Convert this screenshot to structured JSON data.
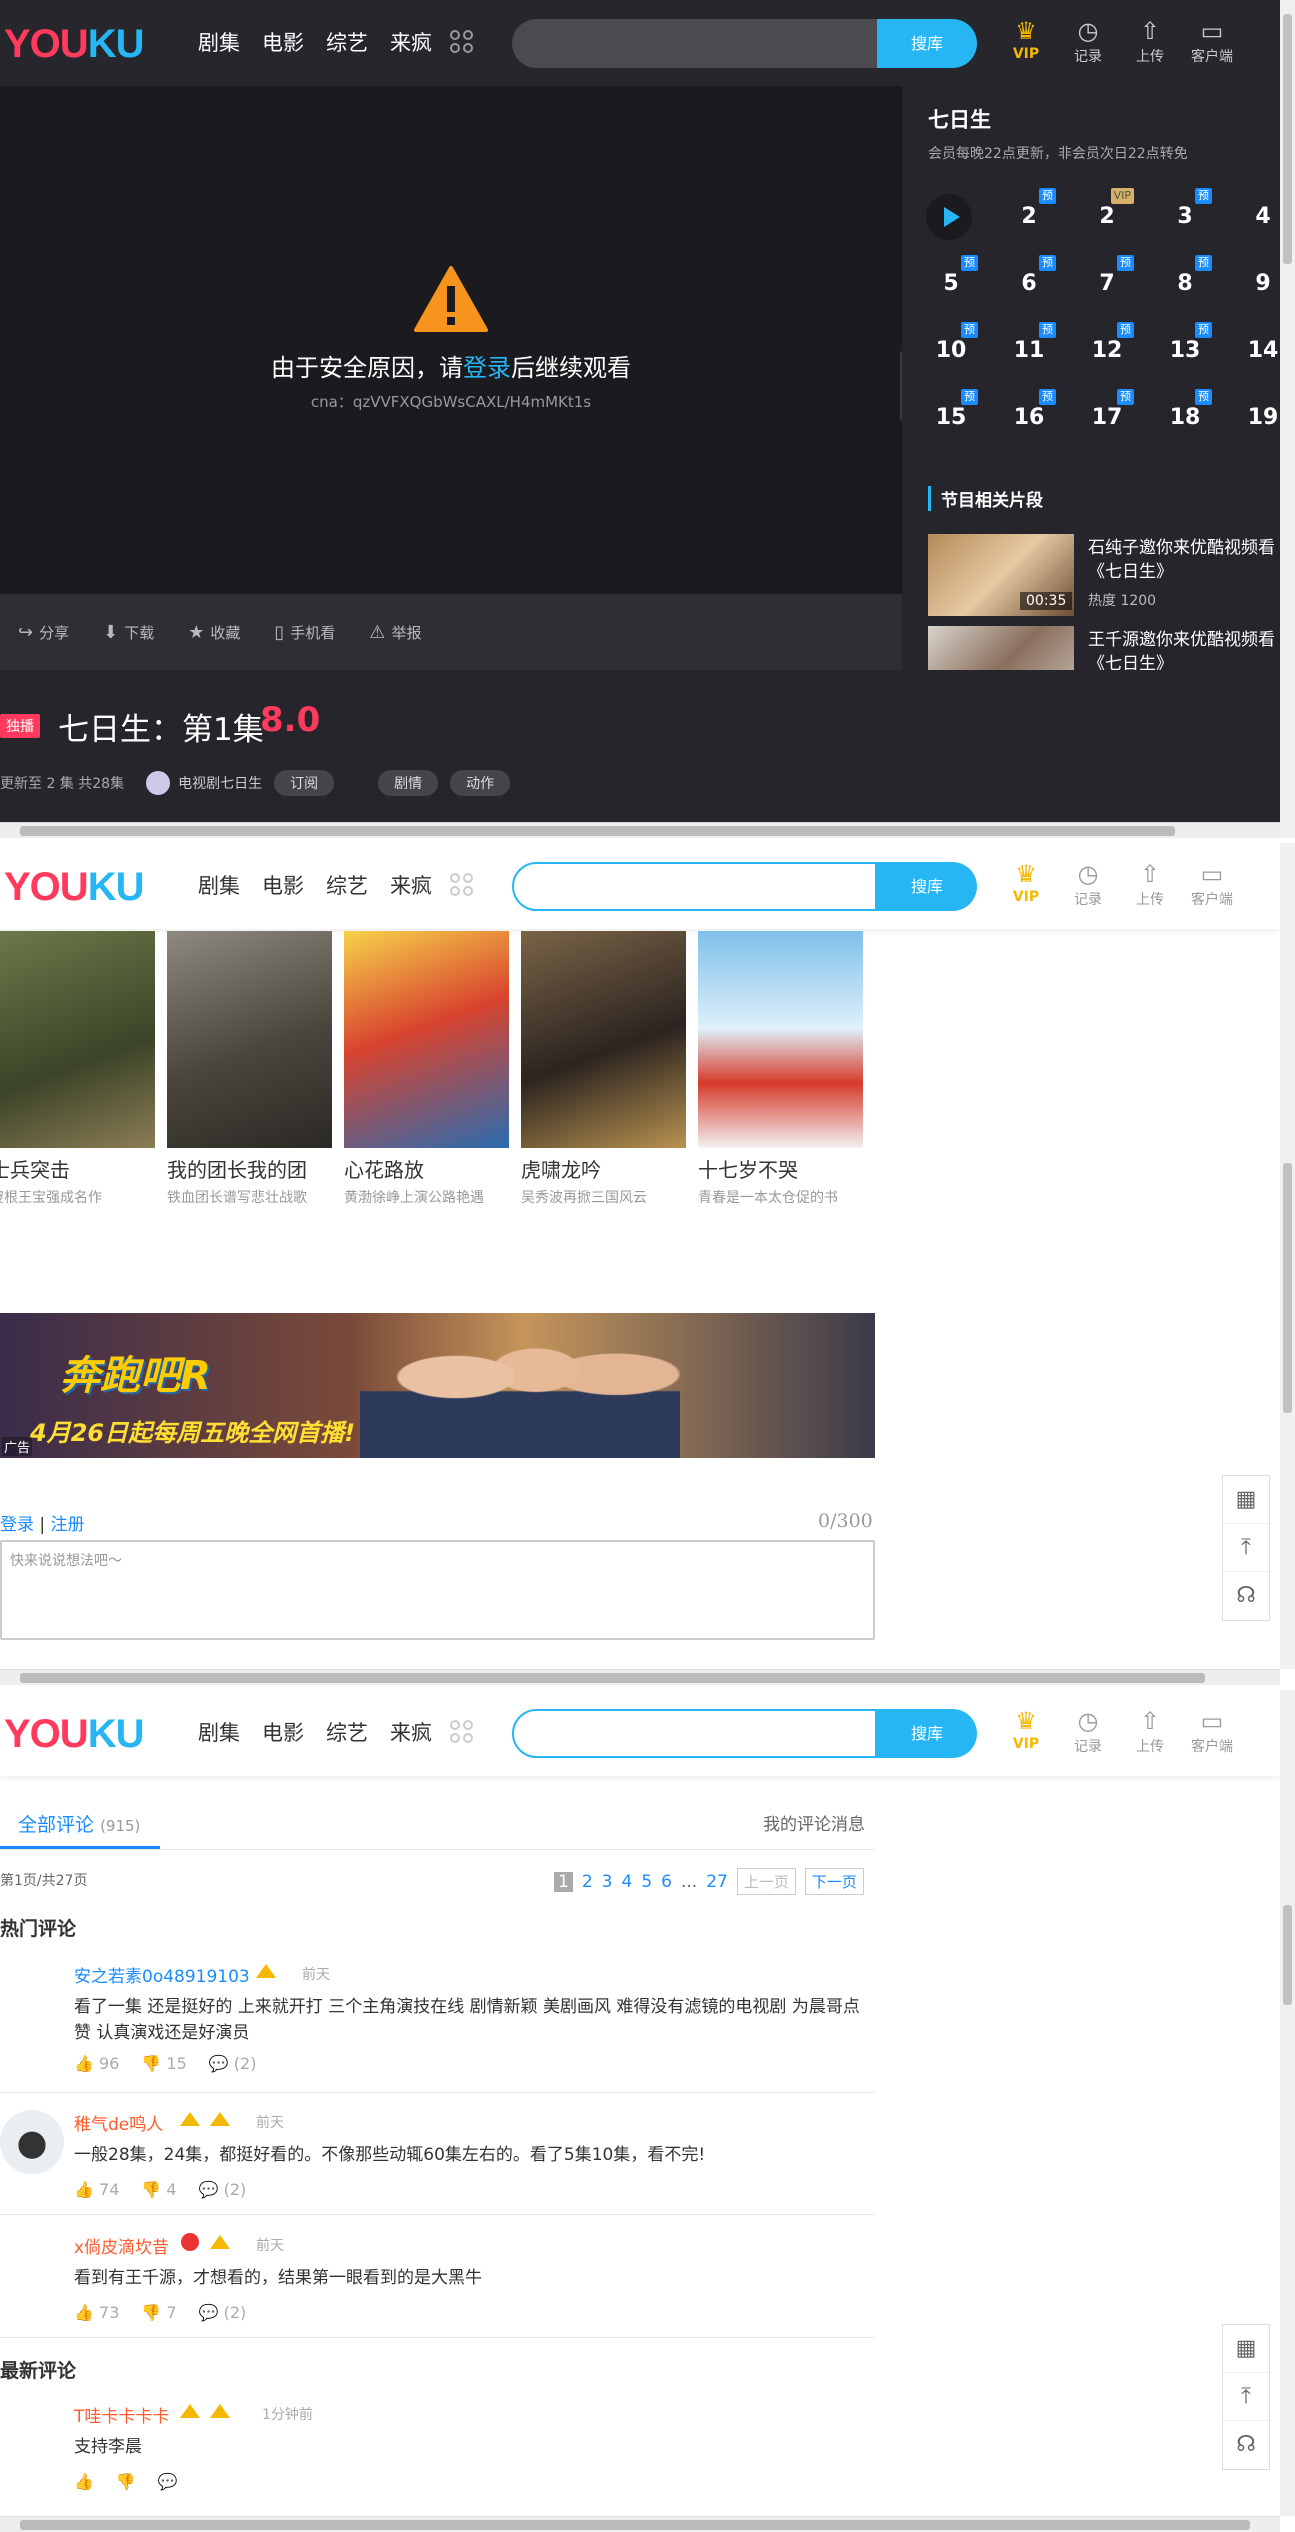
{
  "header": {
    "logo_a": "YOU",
    "logo_b": "KU",
    "nav": [
      "剧集",
      "电影",
      "综艺",
      "来疯"
    ],
    "search_button": "搜库",
    "tools": [
      {
        "icon": "crown-icon",
        "label": "VIP"
      },
      {
        "icon": "clock-icon",
        "label": "记录"
      },
      {
        "icon": "upload-icon",
        "label": "上传"
      },
      {
        "icon": "monitor-icon",
        "label": "客户端"
      }
    ]
  },
  "player": {
    "message_prefix": "由于安全原因，请",
    "message_link": "登录",
    "message_suffix": "后继续观看",
    "cna": "cna：qzVVFXQGbWsCAXL/H4mMKt1s",
    "actions": [
      "分享",
      "下载",
      "收藏",
      "手机看",
      "举报"
    ]
  },
  "sidebar": {
    "title": "七日生",
    "subtitle": "会员每晚22点更新，非会员次日22点转免",
    "episodes": [
      {
        "n": "",
        "tag": ""
      },
      {
        "n": "2",
        "tag": "预"
      },
      {
        "n": "2",
        "tag": "VIP"
      },
      {
        "n": "3",
        "tag": "预"
      },
      {
        "n": "4",
        "tag": ""
      },
      {
        "n": "5",
        "tag": "预"
      },
      {
        "n": "6",
        "tag": "预"
      },
      {
        "n": "7",
        "tag": "预"
      },
      {
        "n": "8",
        "tag": "预"
      },
      {
        "n": "9",
        "tag": ""
      },
      {
        "n": "10",
        "tag": "预"
      },
      {
        "n": "11",
        "tag": "预"
      },
      {
        "n": "12",
        "tag": "预"
      },
      {
        "n": "13",
        "tag": "预"
      },
      {
        "n": "14",
        "tag": ""
      },
      {
        "n": "15",
        "tag": "预"
      },
      {
        "n": "16",
        "tag": "预"
      },
      {
        "n": "17",
        "tag": "预"
      },
      {
        "n": "18",
        "tag": "预"
      },
      {
        "n": "19",
        "tag": ""
      }
    ],
    "related_title": "节目相关片段",
    "clips": [
      {
        "title": "石纯子邀你来优酷视频看《七日生》",
        "duration": "00:35",
        "hot": "热度 1200"
      },
      {
        "title": "王千源邀你来优酷视频看《七日生》",
        "duration": "",
        "hot": ""
      }
    ]
  },
  "video": {
    "exclusive": "独播",
    "title": "七日生：第1集",
    "score": "8.0",
    "update": "更新至 2 集 共28集",
    "channel": "电视剧七日生",
    "subscribe": "订阅",
    "tags": [
      "剧情",
      "动作"
    ]
  },
  "recommend": [
    {
      "name": "士兵突击",
      "desc": "傻根王宝强成名作"
    },
    {
      "name": "我的团长我的团",
      "desc": "铁血团长谱写悲壮战歌"
    },
    {
      "name": "心花路放",
      "desc": "黄渤徐峥上演公路艳遇"
    },
    {
      "name": "虎啸龙吟",
      "desc": "吴秀波再掀三国风云"
    },
    {
      "name": "十七岁不哭",
      "desc": "青春是一本太仓促的书"
    }
  ],
  "banner": {
    "text1": "奔跑吧R",
    "text2": "4月26日起每周五晚全网首播!",
    "ad": "广告"
  },
  "comment_box": {
    "login": "登录",
    "register": "注册",
    "count": "0/300",
    "placeholder": "快来说说想法吧～"
  },
  "comments": {
    "tab": "全部评论",
    "total": "(915)",
    "mine": "我的评论消息",
    "page_info": "第1页/共27页",
    "pages": [
      "1",
      "2",
      "3",
      "4",
      "5",
      "6",
      "...",
      "27"
    ],
    "prev": "上一页",
    "next": "下一页",
    "hot_title": "热门评论",
    "latest_title": "最新评论",
    "hot": [
      {
        "user": "安之若素0o48919103",
        "time": "前天",
        "text": "看了一集 还是挺好的 上来就开打 三个主角演技在线 剧情新颖 美剧画风 难得没有滤镜的电视剧 为晨哥点赞 认真演戏还是好演员",
        "likes": "96",
        "dislikes": "15",
        "replies": "(2)"
      },
      {
        "user": "稚气de鸣人",
        "time": "前天",
        "text": "一般28集，24集，都挺好看的。不像那些动辄60集左右的。看了5集10集，看不完!",
        "likes": "74",
        "dislikes": "4",
        "replies": "(2)"
      },
      {
        "user": "x倘皮滴坎昔",
        "time": "前天",
        "text": "看到有王千源，才想看的，结果第一眼看到的是大黑牛",
        "likes": "73",
        "dislikes": "7",
        "replies": "(2)"
      }
    ],
    "latest": [
      {
        "user": "T哇卡卡卡卡",
        "time": "1分钟前",
        "text": "支持李晨",
        "likes": "",
        "dislikes": "",
        "replies": ""
      }
    ]
  },
  "colors": {
    "accent": "#26b6f4",
    "brand_red": "#ff3a5c",
    "link": "#1a8cff"
  }
}
